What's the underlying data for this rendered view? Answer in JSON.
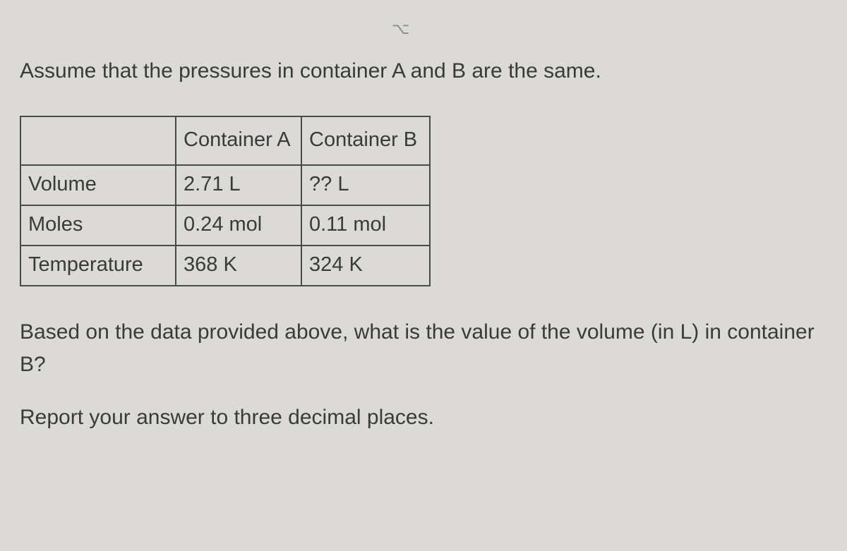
{
  "glyph": "⌥",
  "lead_text": "Assume that the pressures in container A and B are the same.",
  "table": {
    "blank_header": "",
    "col_a_header": "Container A",
    "col_b_header": "Container B",
    "rows": [
      {
        "label": "Volume",
        "a": "2.71 L",
        "b": "?? L"
      },
      {
        "label": "Moles",
        "a": "0.24 mol",
        "b": "0.11 mol"
      },
      {
        "label": "Temperature",
        "a": "368 K",
        "b": "324 K"
      }
    ]
  },
  "question_text": "Based on the data provided above, what is the value of the volume (in L) in container B?",
  "instruction_text": "Report your answer to three decimal places."
}
